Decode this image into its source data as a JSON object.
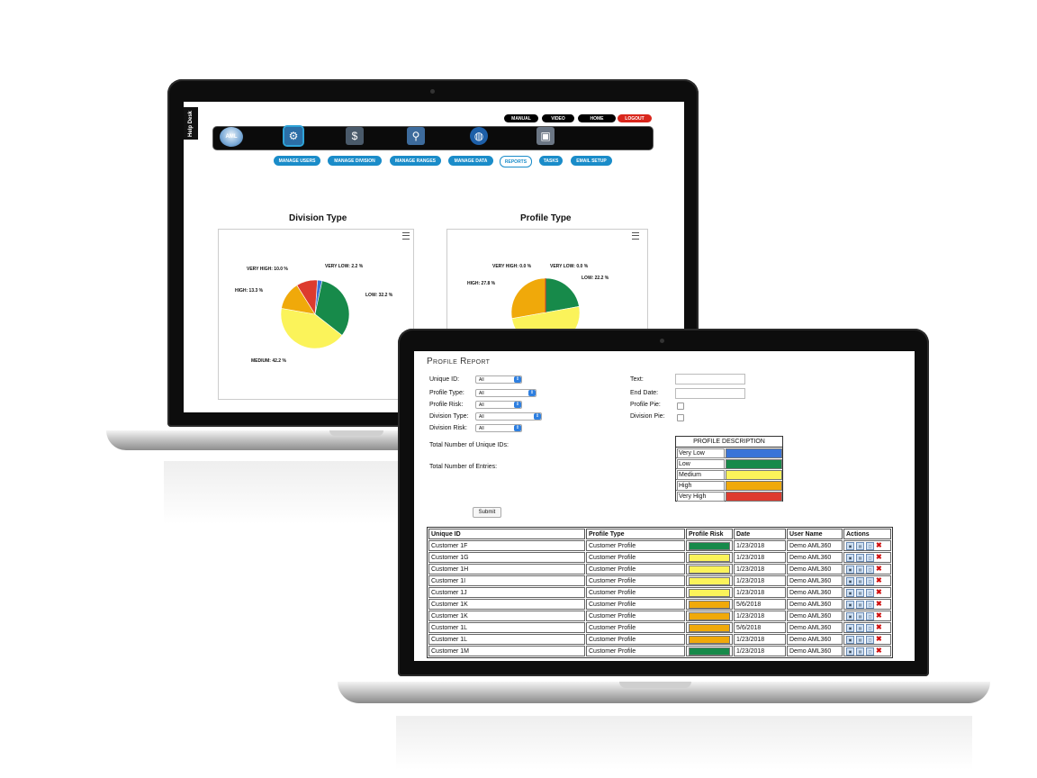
{
  "colors": {
    "very_low": "#3a74d8",
    "low": "#178a4a",
    "medium": "#fbf35a",
    "high": "#f0a90a",
    "very_high": "#dd3b2e",
    "logout": "#d9261c",
    "nav_blue": "#1a8cc9"
  },
  "laptop_back": {
    "help_desk": "Help Desk",
    "logo": "AML",
    "top_buttons": [
      "MANUAL",
      "VIDEO",
      "HOME",
      "LOGOUT"
    ],
    "nav_icons": [
      "gears-icon",
      "money-icon",
      "user-location-icon",
      "globe-icon",
      "briefcase-icon"
    ],
    "sub_nav": [
      "MANAGE USERS",
      "MANAGE DIVISION",
      "MANAGE RANGES",
      "MANAGE DATA",
      "REPORTS",
      "TASKS",
      "EMAIL SETUP"
    ],
    "selected_sub_nav": "REPORTS"
  },
  "chart_data": [
    {
      "type": "pie",
      "title": "Division Type",
      "slices": [
        {
          "label": "VERY LOW: 2.2 %",
          "value": 2.2,
          "color": "#3a74d8"
        },
        {
          "label": "LOW: 32.2 %",
          "value": 32.2,
          "color": "#178a4a"
        },
        {
          "label": "MEDIUM: 42.2 %",
          "value": 42.2,
          "color": "#fbf35a"
        },
        {
          "label": "HIGH: 13.3 %",
          "value": 13.3,
          "color": "#f0a90a"
        },
        {
          "label": "VERY HIGH: 10.0 %",
          "value": 10.0,
          "color": "#dd3b2e"
        }
      ]
    },
    {
      "type": "pie",
      "title": "Profile Type",
      "slices": [
        {
          "label": "VERY LOW: 0.0 %",
          "value": 0.0,
          "color": "#3a74d8"
        },
        {
          "label": "LOW: 22.2 %",
          "value": 22.2,
          "color": "#178a4a"
        },
        {
          "label": "",
          "value": 50.0,
          "color": "#fbf35a"
        },
        {
          "label": "HIGH: 27.8 %",
          "value": 27.8,
          "color": "#f0a90a"
        },
        {
          "label": "VERY HIGH: 0.0 %",
          "value": 0.0,
          "color": "#dd3b2e"
        }
      ]
    }
  ],
  "report": {
    "title": "Profile Report",
    "filters": {
      "unique_id": {
        "label": "Unique ID:",
        "value": "All"
      },
      "profile_type": {
        "label": "Profile Type:",
        "value": "All"
      },
      "profile_risk": {
        "label": "Profile Risk:",
        "value": "All"
      },
      "division_type": {
        "label": "Division Type:",
        "value": "All"
      },
      "division_risk": {
        "label": "Division Risk:",
        "value": "All"
      },
      "text": {
        "label": "Text:"
      },
      "end_date": {
        "label": "End Date:"
      },
      "profile_pie": {
        "label": "Profile Pie:"
      },
      "division_pie": {
        "label": "Division Pie:"
      }
    },
    "total_unique_ids_label": "Total Number of Unique IDs:",
    "total_entries_label": "Total Number of Entries:",
    "submit_label": "Submit",
    "description": {
      "header": "PROFILE DESCRIPTION",
      "items": [
        {
          "name": "Very Low",
          "color": "#3a74d8"
        },
        {
          "name": "Low",
          "color": "#178a4a"
        },
        {
          "name": "Medium",
          "color": "#fbf35a"
        },
        {
          "name": "High",
          "color": "#f0a90a"
        },
        {
          "name": "Very High",
          "color": "#dd3b2e"
        }
      ]
    },
    "columns": [
      "Unique ID",
      "Profile Type",
      "Profile Risk",
      "Date",
      "User Name",
      "Actions"
    ],
    "rows": [
      {
        "id": "Customer 1F",
        "type": "Customer Profile",
        "risk": "Low",
        "date": "1/23/2018",
        "user": "Demo AML360"
      },
      {
        "id": "Customer 1G",
        "type": "Customer Profile",
        "risk": "Medium",
        "date": "1/23/2018",
        "user": "Demo AML360"
      },
      {
        "id": "Customer 1H",
        "type": "Customer Profile",
        "risk": "Medium",
        "date": "1/23/2018",
        "user": "Demo AML360"
      },
      {
        "id": "Customer 1I",
        "type": "Customer Profile",
        "risk": "Medium",
        "date": "1/23/2018",
        "user": "Demo AML360"
      },
      {
        "id": "Customer 1J",
        "type": "Customer Profile",
        "risk": "Medium",
        "date": "1/23/2018",
        "user": "Demo AML360"
      },
      {
        "id": "Customer 1K",
        "type": "Customer Profile",
        "risk": "High",
        "date": "5/6/2018",
        "user": "Demo AML360"
      },
      {
        "id": "Customer 1K",
        "type": "Customer Profile",
        "risk": "High",
        "date": "1/23/2018",
        "user": "Demo AML360"
      },
      {
        "id": "Customer 1L",
        "type": "Customer Profile",
        "risk": "High",
        "date": "5/6/2018",
        "user": "Demo AML360"
      },
      {
        "id": "Customer 1L",
        "type": "Customer Profile",
        "risk": "High",
        "date": "1/23/2018",
        "user": "Demo AML360"
      },
      {
        "id": "Customer 1M",
        "type": "Customer Profile",
        "risk": "Low",
        "date": "1/23/2018",
        "user": "Demo AML360"
      }
    ],
    "action_icons": [
      "view-icon",
      "edit-icon",
      "copy-icon",
      "delete-icon"
    ]
  }
}
